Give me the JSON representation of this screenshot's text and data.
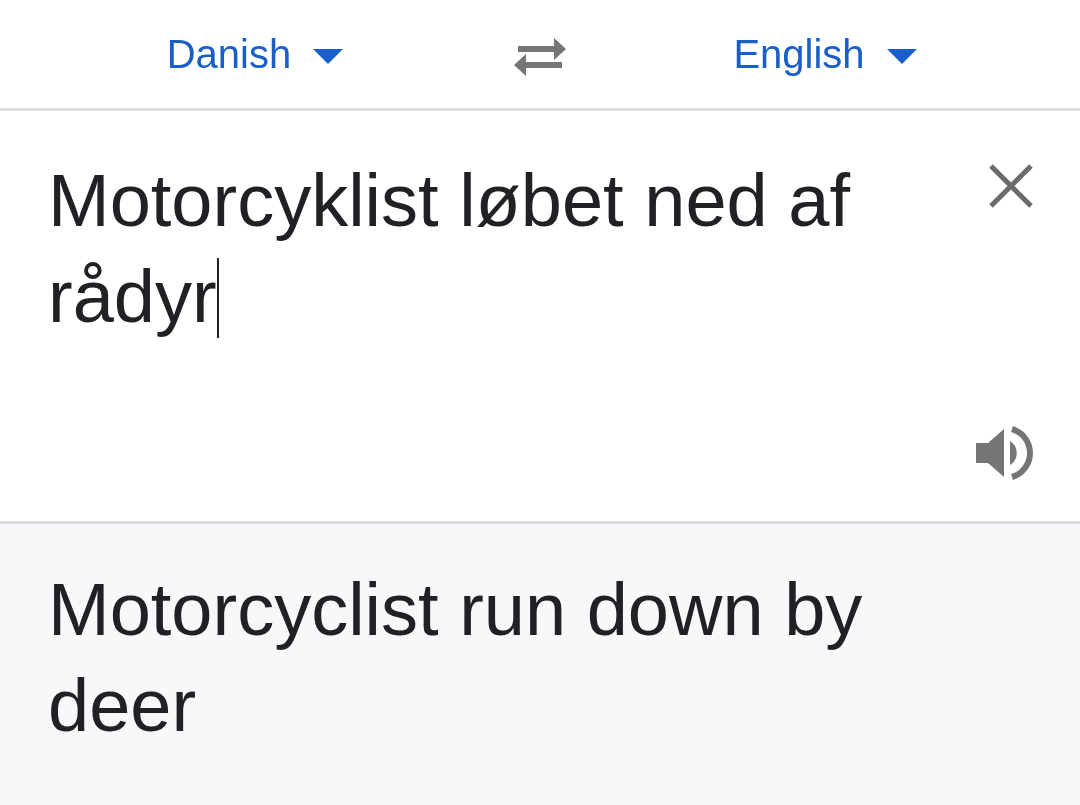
{
  "languages": {
    "source": {
      "label": "Danish"
    },
    "target": {
      "label": "English"
    }
  },
  "input": {
    "value": "Motorcyklist løbet ned af rådyr",
    "focused": true
  },
  "translation": {
    "text": "Motorcyclist run down by deer"
  }
}
